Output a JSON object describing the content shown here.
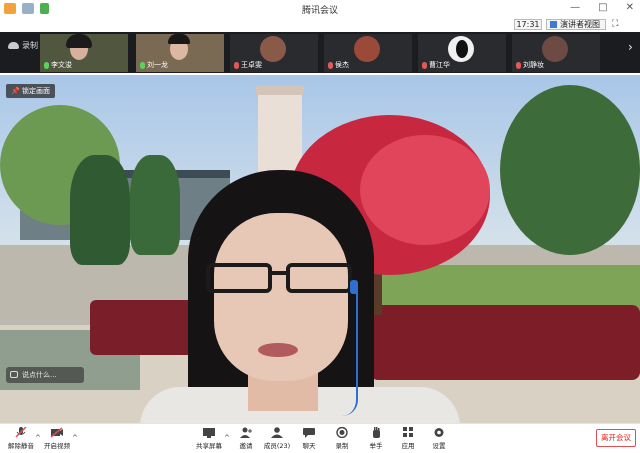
{
  "window": {
    "title": "腾讯会议"
  },
  "header": {
    "time": "17:31",
    "view_label": "演讲者视图"
  },
  "recording": {
    "label": "录制"
  },
  "participants": [
    {
      "name": "李文浚",
      "mic": "on"
    },
    {
      "name": "刘一龙",
      "mic": "on"
    },
    {
      "name": "王卓雯",
      "mic": "off"
    },
    {
      "name": "侯杰",
      "mic": "off"
    },
    {
      "name": "曹江华",
      "mic": "off"
    },
    {
      "name": "刘静妆",
      "mic": "off"
    }
  ],
  "main": {
    "pin_label": "锁定画面",
    "chat_placeholder": "说点什么..."
  },
  "toolbar": {
    "mute": "解除静音",
    "video": "开启视频",
    "share": "共享屏幕",
    "invite": "邀请",
    "members": "成员(23)",
    "chat": "聊天",
    "record": "录制",
    "hand": "举手",
    "apps": "应用",
    "settings": "设置",
    "leave": "离开会议"
  },
  "colors": {
    "accent": "#2f6fd1",
    "leave": "#d22222",
    "strip_bg": "#1b1c1f"
  }
}
